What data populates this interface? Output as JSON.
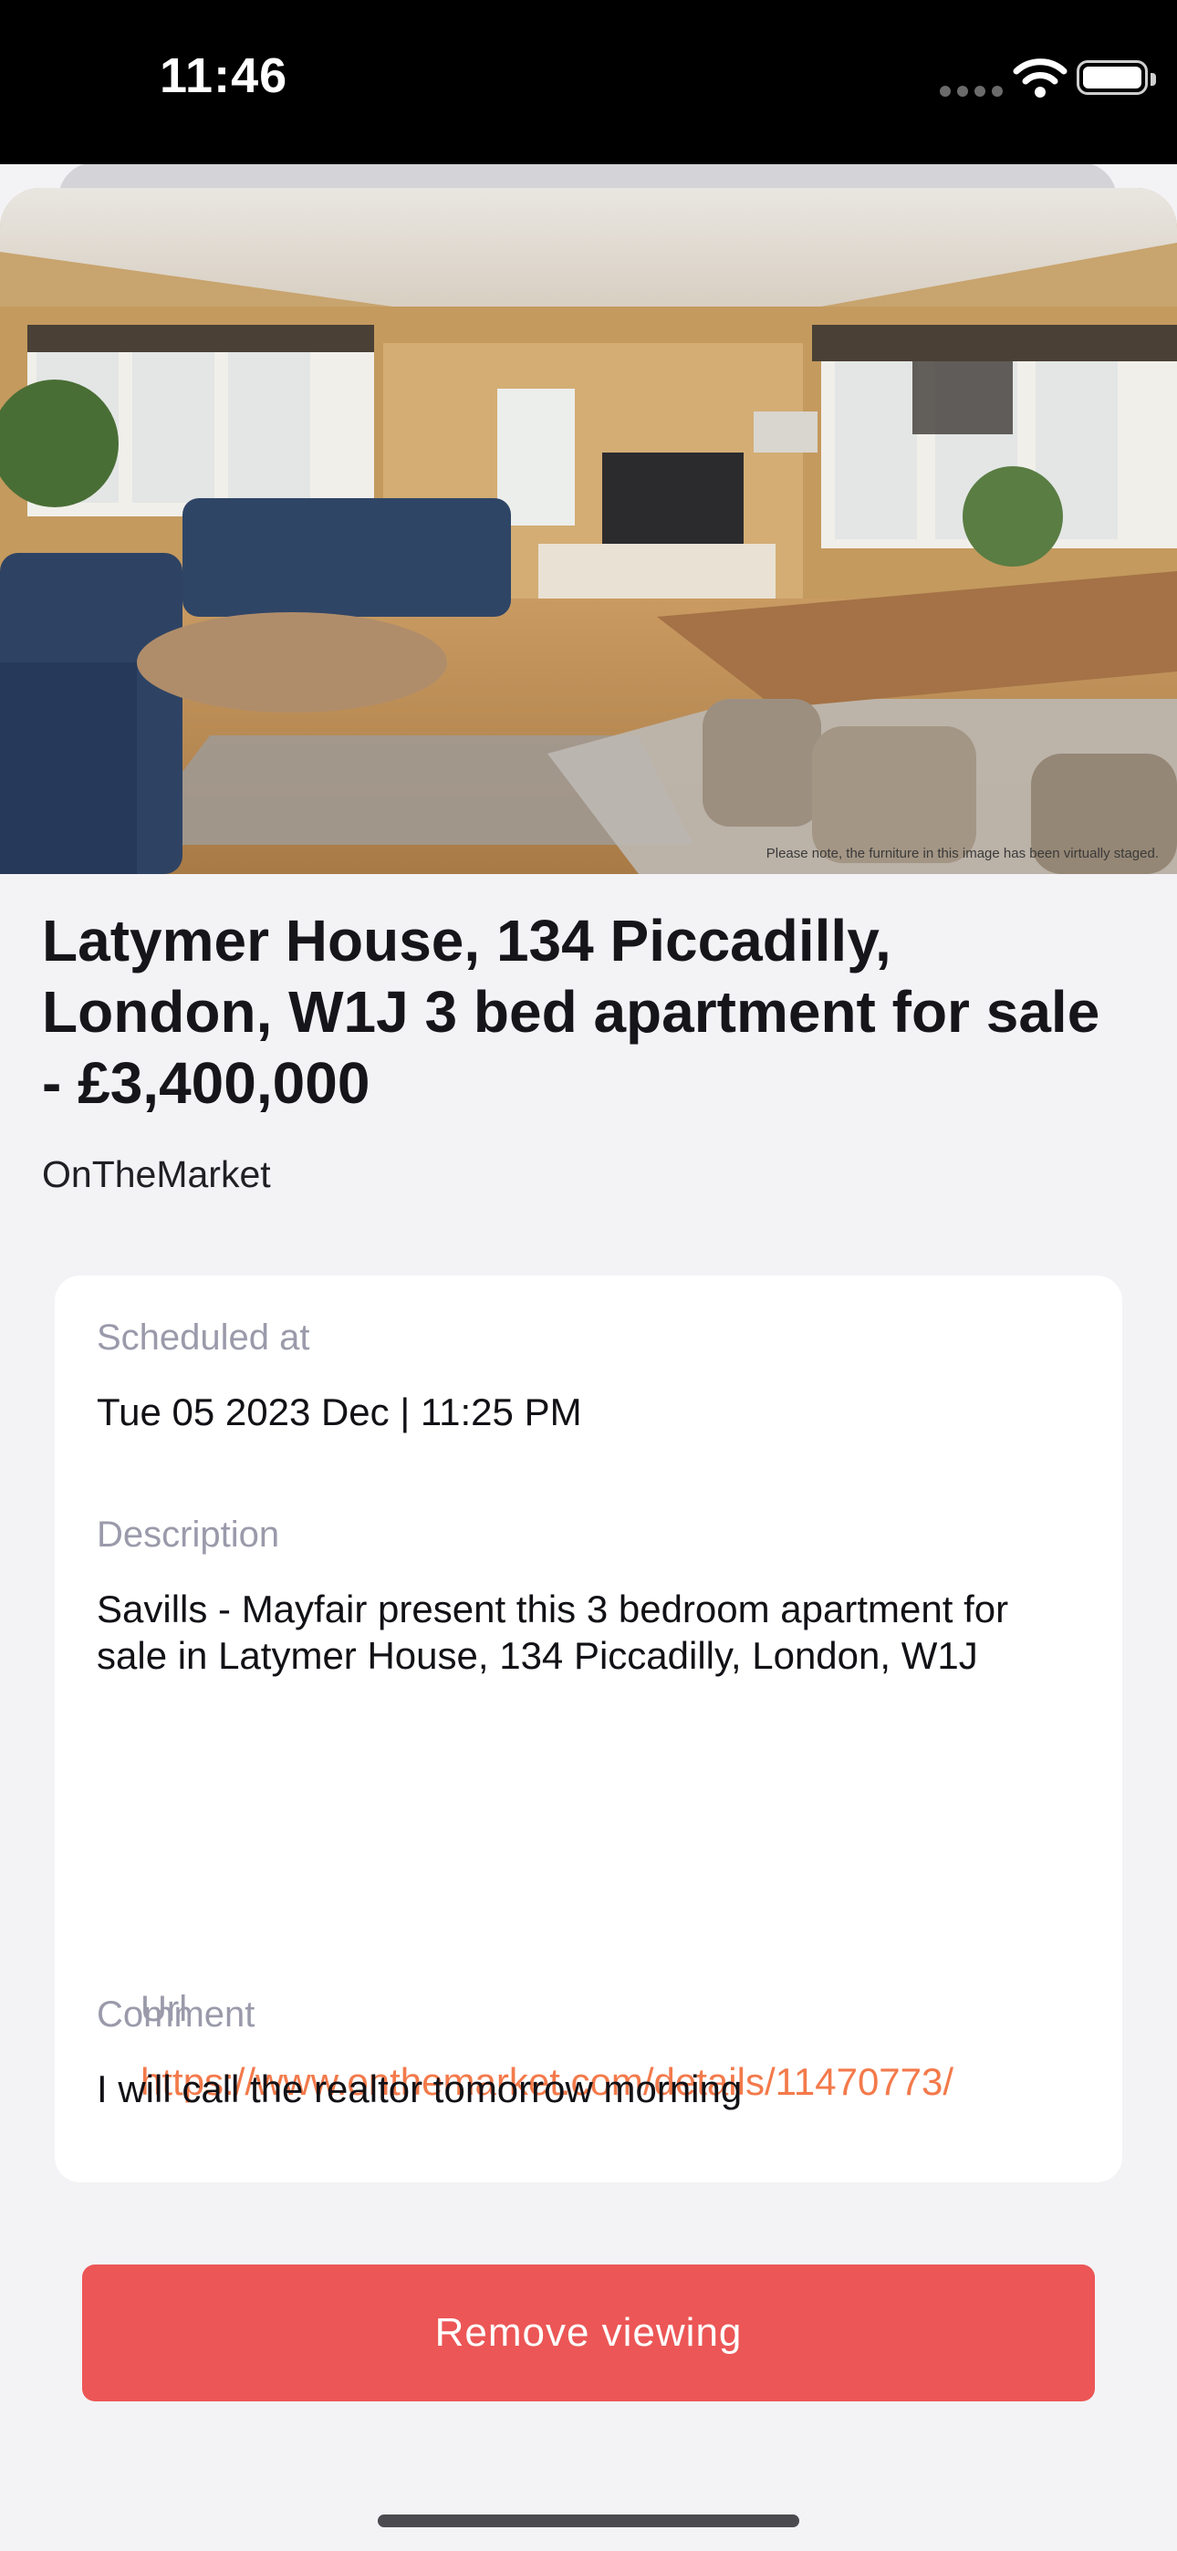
{
  "status_bar": {
    "time": "11:46",
    "icons": [
      "cellular-signal-icon",
      "wifi-icon",
      "battery-icon"
    ]
  },
  "hero": {
    "caption": "Please note, the furniture in this image has been virtually staged."
  },
  "listing": {
    "title": "Latymer House, 134 Piccadilly, London, W1J 3 bed apartment for sale - £3,400,000",
    "source": "OnTheMarket"
  },
  "details": {
    "scheduled_label": "Scheduled at",
    "scheduled_value": "Tue 05 2023 Dec | 11:25 PM",
    "description_label": "Description",
    "description_value": "Savills - Mayfair present this 3 bedroom apartment for sale in Latymer House, 134 Piccadilly, London, W1J",
    "url_label": "Url",
    "url_value": "https://www.onthemarket.com/details/11470773/",
    "comment_label": "Comment",
    "comment_value": "I will call the realtor tomorrow morning"
  },
  "actions": {
    "remove_label": "Remove viewing"
  },
  "colors": {
    "accent_link": "#f37a4b",
    "danger_button": "#ec5656",
    "label_gray": "#9a9aab",
    "sheet_background": "#f3f3f6"
  }
}
